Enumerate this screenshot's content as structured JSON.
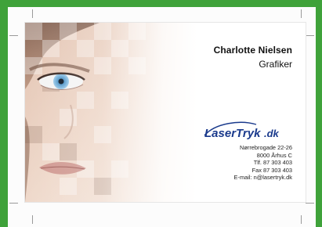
{
  "card": {
    "name": "Charlotte Nielsen",
    "role": "Grafiker",
    "logo": {
      "text_main": "LaserTryk",
      "text_suffix": ".dk",
      "brand_color": "#1a3a8c"
    },
    "address_lines": [
      "Nørrebrogade 22-26",
      "8000 Århus C",
      "Tlf. 87 303 403",
      "Fax 87 303 403",
      "E-mail: n@lasertryk.dk"
    ]
  },
  "colors": {
    "background": "#3fa23a",
    "sheet": "#fcfcfc",
    "eye": "#6fb4e0"
  }
}
